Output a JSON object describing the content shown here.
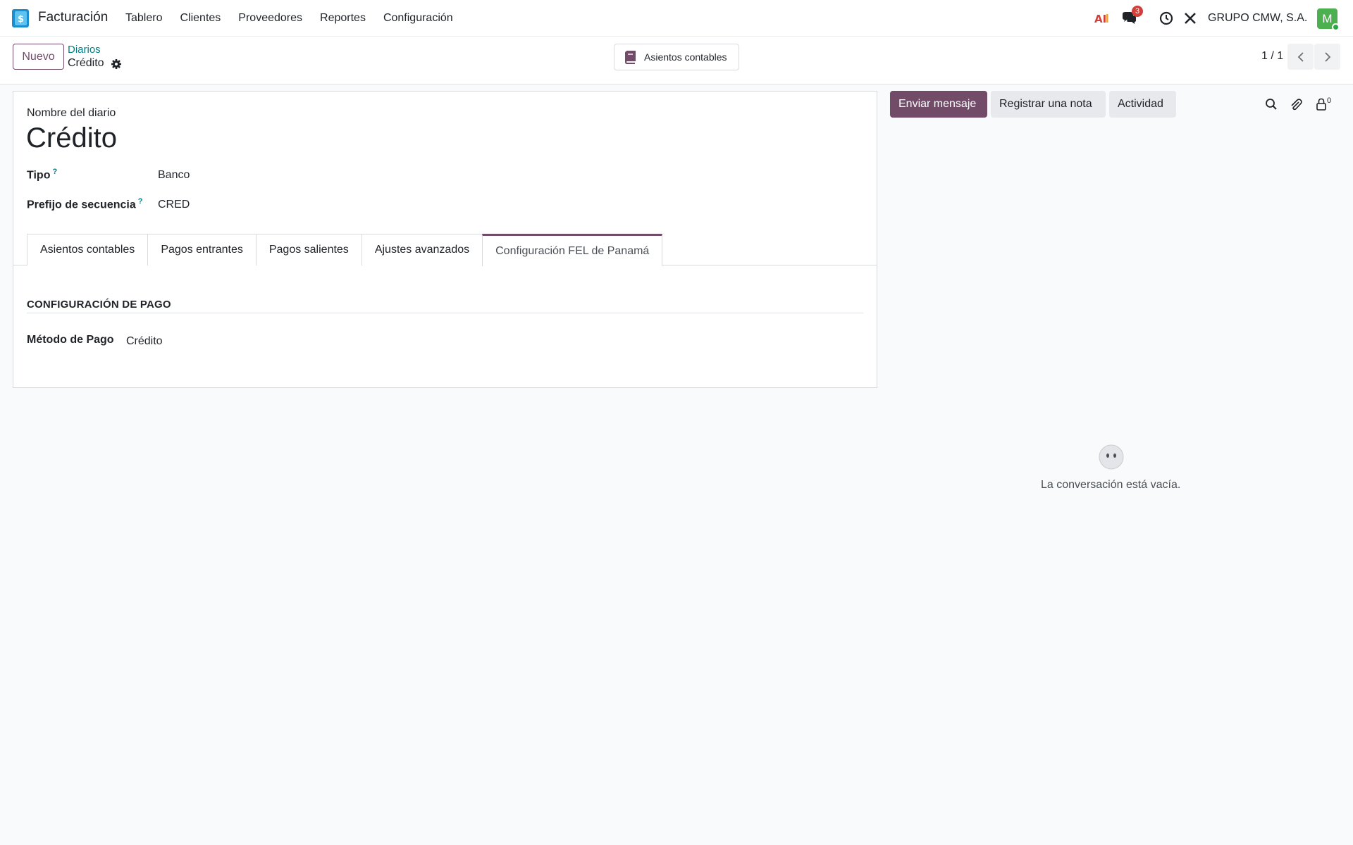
{
  "navbar": {
    "app_name": "Facturación",
    "menu": [
      "Tablero",
      "Clientes",
      "Proveedores",
      "Reportes",
      "Configuración"
    ],
    "messages_count": "3",
    "company": "GRUPO CMW, S.A.",
    "avatar_initial": "M",
    "ai_label": "AI"
  },
  "control": {
    "new_label": "Nuevo",
    "breadcrumb_parent": "Diarios",
    "breadcrumb_current": "Crédito",
    "smart_button": "Asientos contables",
    "pager": "1 / 1"
  },
  "form": {
    "name_label": "Nombre del diario",
    "name_value": "Crédito",
    "type_label": "Tipo",
    "type_value": "Banco",
    "prefix_label": "Prefijo de secuencia",
    "prefix_value": "CRED",
    "help_mark": "?",
    "tabs": [
      "Asientos contables",
      "Pagos entrantes",
      "Pagos salientes",
      "Ajustes avanzados",
      "Configuración FEL de Panamá"
    ],
    "active_tab": "Configuración FEL de Panamá",
    "section_title": "CONFIGURACIÓN DE PAGO",
    "payment_method_label": "Método de Pago",
    "payment_method_value": "Crédito"
  },
  "chatter": {
    "send_message": "Enviar mensaje",
    "log_note": "Registrar una nota",
    "activity": "Actividad",
    "followers_count": "0",
    "empty_text": "La conversación está vacía."
  },
  "colors": {
    "brand": "#714b67",
    "link": "#017e84",
    "badge": "#d23f3a",
    "avatar": "#4caf50"
  }
}
